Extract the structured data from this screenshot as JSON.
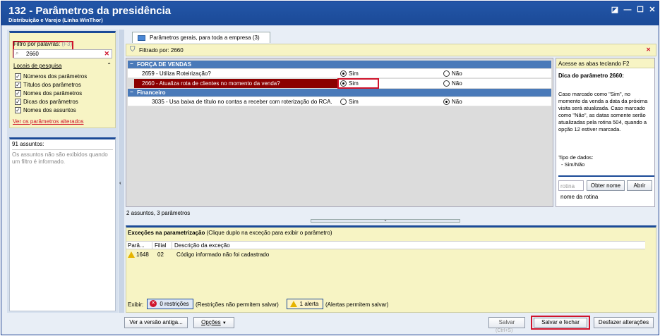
{
  "window": {
    "title": "132 - Parâmetros da presidência",
    "subtitle": "Distribuição e Varejo (Linha WinThor)",
    "controls": [
      "◪",
      "—",
      "☐",
      "✕"
    ]
  },
  "sidebar": {
    "filter_label": "Filtro por palavras:",
    "filter_shortcut": "(F3)",
    "filter_value": "2660",
    "locations_title": "Locais de pesquisa",
    "locations": [
      {
        "label": "Números dos parâmetros",
        "checked": true
      },
      {
        "label": "Títulos dos parâmetros",
        "checked": true
      },
      {
        "label": "Nomes dos parâmetros",
        "checked": true
      },
      {
        "label": "Dicas dos parâmetros",
        "checked": true
      },
      {
        "label": "Nomes dos assuntos",
        "checked": true
      }
    ],
    "altered_link": "Ver os parâmetros alterados",
    "subjects_title": "91 assuntos:",
    "subjects_note": "Os assuntos não são exibidos quando um filtro é informado."
  },
  "tab": {
    "label": "Parâmetros gerais, para toda a empresa",
    "count": "(3)"
  },
  "filter_bar": {
    "text": "Filtrado por: 2660"
  },
  "groups": [
    {
      "name": "FORÇA DE VENDAS"
    },
    {
      "name": "Financeiro"
    }
  ],
  "params": [
    {
      "label": "2659 - Utiliza Roteirização?",
      "yes": "Sim",
      "no": "Não",
      "value": "Sim"
    },
    {
      "label": "2660 - Atualiza rota de clientes no momento da venda?",
      "yes": "Sim",
      "no": "Não",
      "value": "Sim"
    },
    {
      "label": "3035 - Usa baixa de título no contas a receber com roterização do RCA.",
      "yes": "Sim",
      "no": "Não",
      "value": "Não"
    }
  ],
  "summary": "2 assuntos, 3 parâmetros",
  "hint_panel": {
    "header": "Acesse as abas teclando F2",
    "title": "Dica do parâmetro 2660:",
    "body": "Caso marcado como \"Sim\", no momento da venda a data da próxima visita será atualizada. Caso marcado como \"Não\", as datas somente serão atualizadas pela rotina 504, quando a opção 12 estiver marcada.",
    "data_type_label": "Tipo de dados:",
    "data_type_value": "- Sim/Não",
    "routine_placeholder": "rotina",
    "get_name_button": "Obter nome",
    "open_button": "Abrir",
    "routine_name": "nome da rotina"
  },
  "exceptions": {
    "title": "Exceções na parametrização",
    "hint": "(Clique duplo na exceção para exibir o parâmetro)",
    "columns": [
      "Parâ...",
      "Filial",
      "Descrição da exceção"
    ],
    "rows": [
      {
        "param": "1648",
        "branch": "02",
        "description": "Código informado não foi cadastrado"
      }
    ],
    "show_label": "Exibir:",
    "restrictions_button": "0 restrições",
    "restrictions_note": "(Restrições não permitem salvar)",
    "alerts_button": "1 alerta",
    "alerts_note": "(Alertas permitem salvar)"
  },
  "footer": {
    "old_version_button": "Ver a versão antiga...",
    "options_button": "Opções",
    "save_button": "Salvar",
    "save_shortcut": "(Ctrl+S)",
    "save_close_button": "Salvar e fechar",
    "undo_button": "Desfazer alterações"
  },
  "colors": {
    "title_bar": "#1b4a97",
    "group_header": "#4a7ab9",
    "selected_row": "#8b0000",
    "highlight": "#d0142b",
    "panel_yellow": "#f7f4c4"
  }
}
